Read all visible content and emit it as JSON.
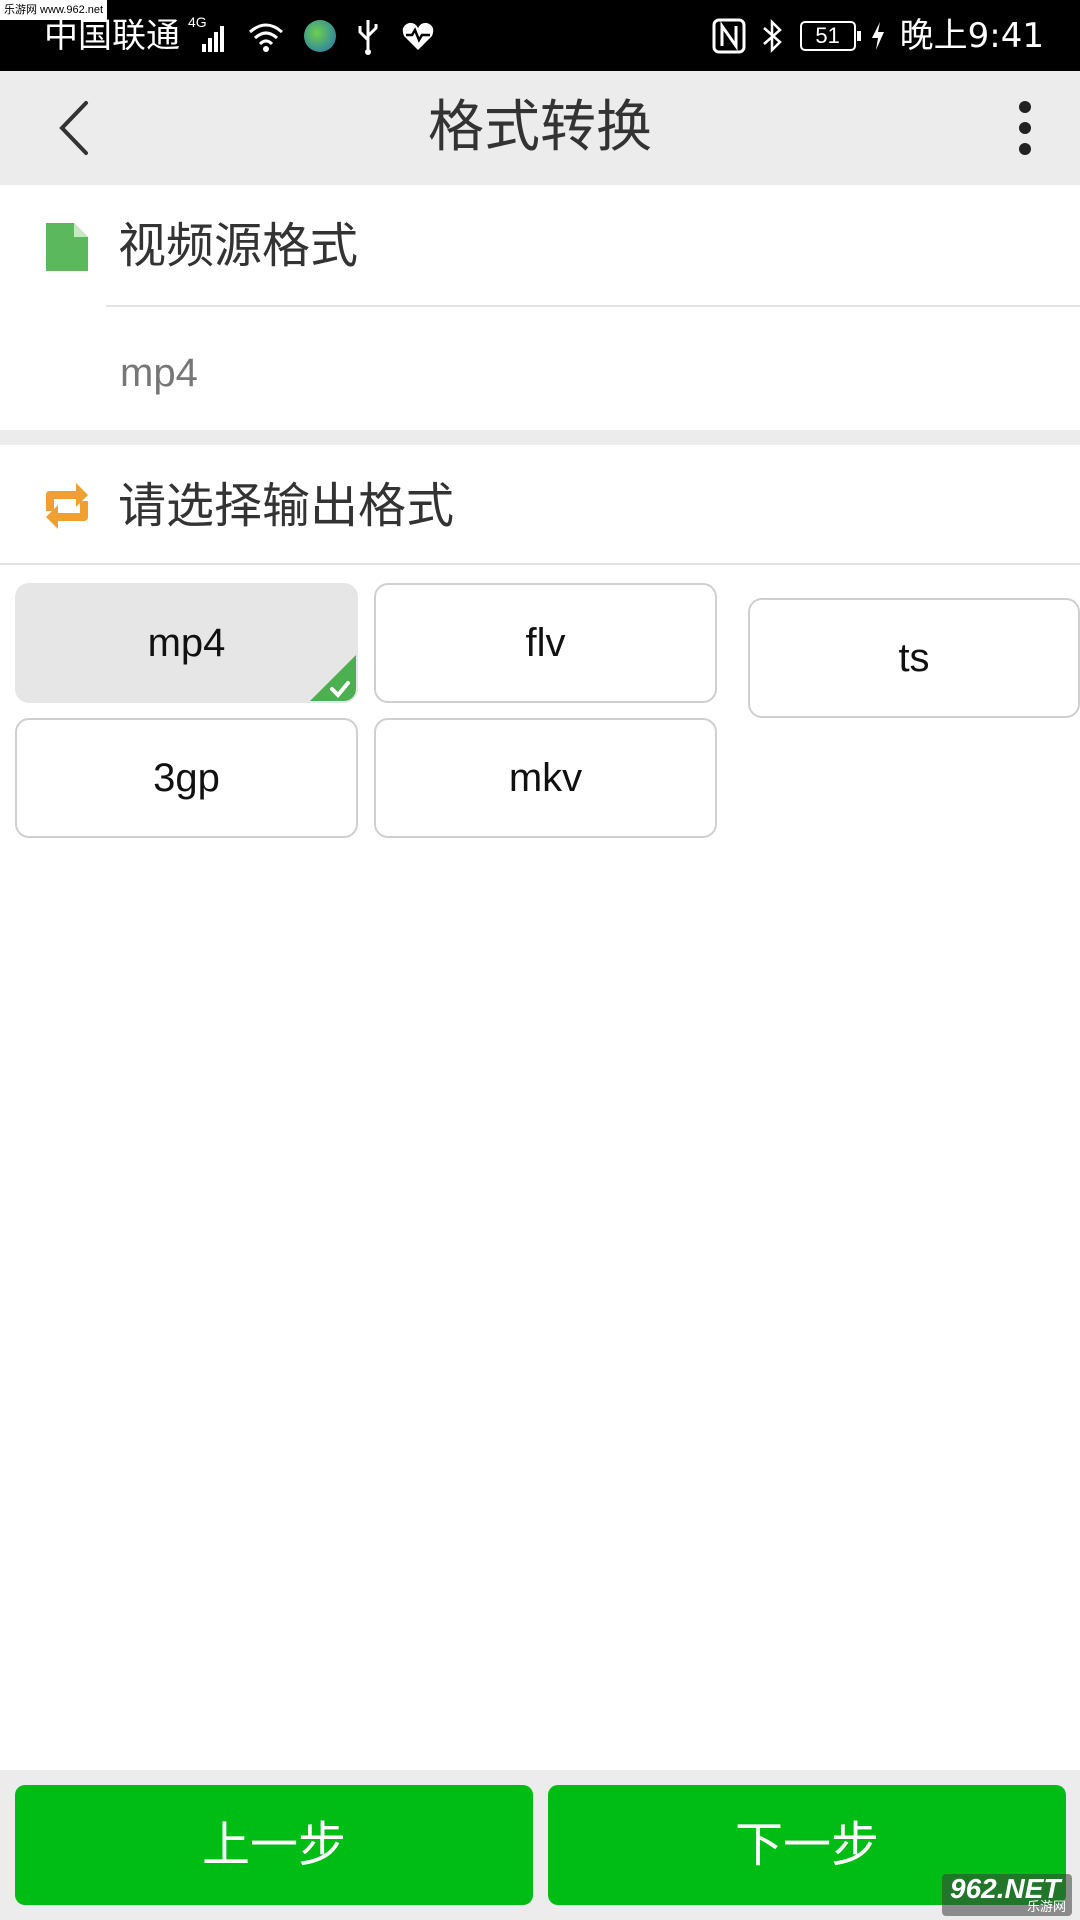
{
  "status_bar": {
    "watermark": "乐游网 www.962.net",
    "carrier": "中国联通",
    "network": "4G",
    "battery": "51",
    "time": "晚上9:41",
    "icons_left": [
      "signal-icon",
      "wifi-icon",
      "globe-icon",
      "usb-icon",
      "heart-rate-icon"
    ],
    "icons_right": [
      "nfc-icon",
      "bluetooth-icon",
      "battery-icon",
      "charging-icon"
    ]
  },
  "header": {
    "title": "格式转换",
    "back_icon": "chevron-left-icon",
    "more_icon": "more-vertical-icon"
  },
  "source": {
    "title": "视频源格式",
    "value": "mp4",
    "icon": "document-icon",
    "icon_color": "#5cb85c"
  },
  "output": {
    "title": "请选择输出格式",
    "icon": "convert-icon",
    "icon_color": "#f0a030",
    "selected": "mp4",
    "formats": [
      "mp4",
      "flv",
      "ts",
      "3gp",
      "mkv"
    ]
  },
  "footer": {
    "prev_label": "上一步",
    "next_label": "下一步",
    "button_color": "#00bd16"
  },
  "watermark_bottom": {
    "big": "962.NET",
    "small": "乐游网"
  }
}
